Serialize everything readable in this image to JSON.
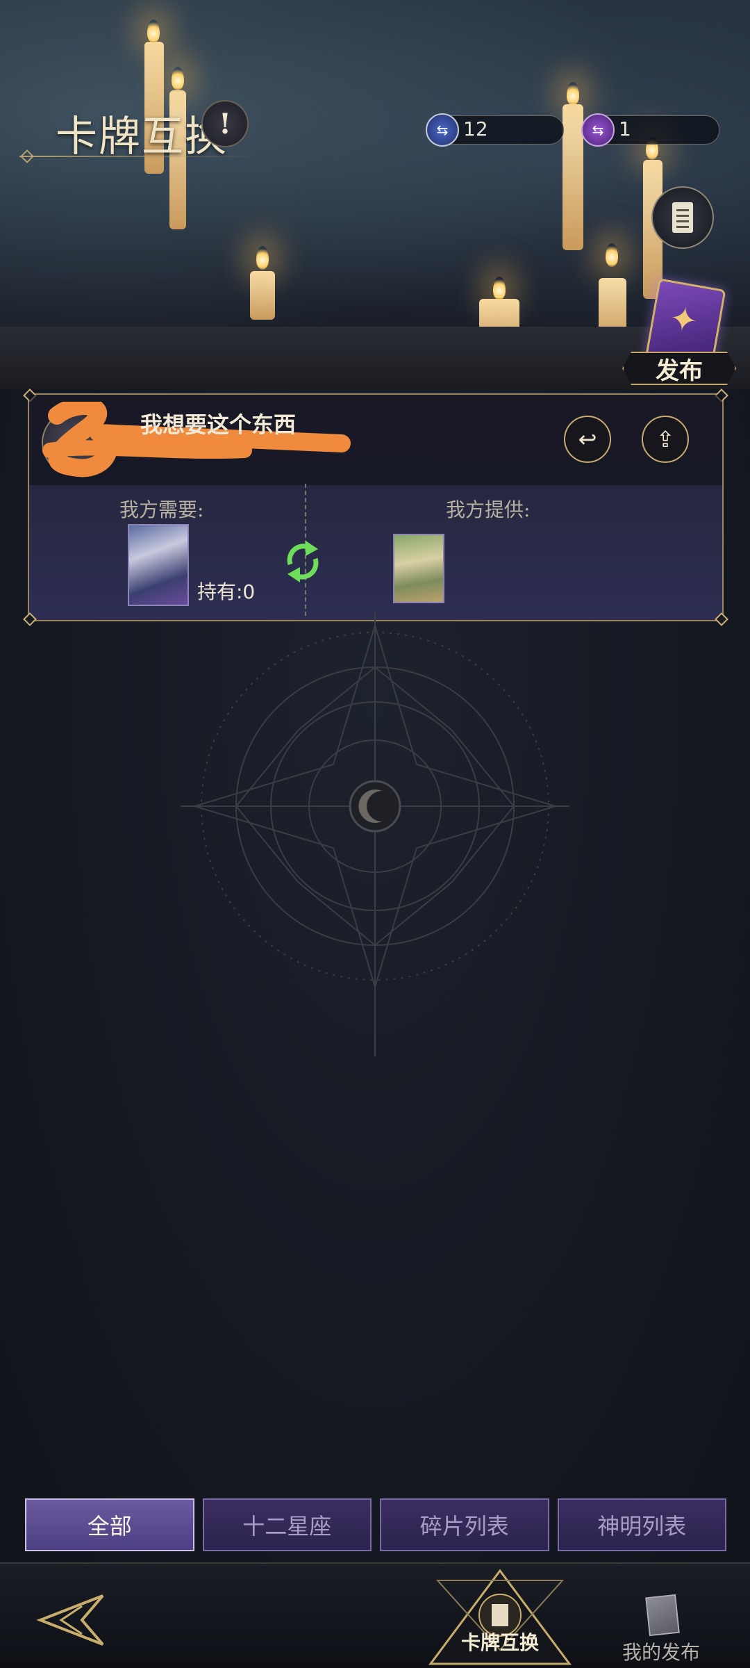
{
  "header": {
    "title": "卡牌互换",
    "info_icon": "exclamation-icon",
    "currencies": [
      {
        "icon": "exchange-ticket-blue-icon",
        "value": "12",
        "color": "#3a5bb8"
      },
      {
        "icon": "exchange-ticket-purple-icon",
        "value": "1",
        "color": "#8a48c4"
      }
    ],
    "log_icon": "record-list-icon",
    "publish_label": "发布"
  },
  "trade": {
    "note": "我想要这个东西",
    "need_label": "我方需要:",
    "offer_label": "我方提供:",
    "hold_text": "持有:0",
    "back_icon": "return-arrow-icon",
    "share_icon": "share-icon",
    "swap_icon": "swap-arrows-icon"
  },
  "tabs": [
    {
      "label": "全部",
      "active": true
    },
    {
      "label": "十二星座",
      "active": false
    },
    {
      "label": "碎片列表",
      "active": false
    },
    {
      "label": "神明列表",
      "active": false
    }
  ],
  "nav": {
    "back_icon": "back-arrow-icon",
    "center_label": "卡牌互换",
    "my_publish_label": "我的发布"
  },
  "colors": {
    "gold": "#c9ad6d",
    "accent_purple": "#6a5aa0",
    "swap_green": "#6fdc5a",
    "redaction": "#f08a3c"
  }
}
